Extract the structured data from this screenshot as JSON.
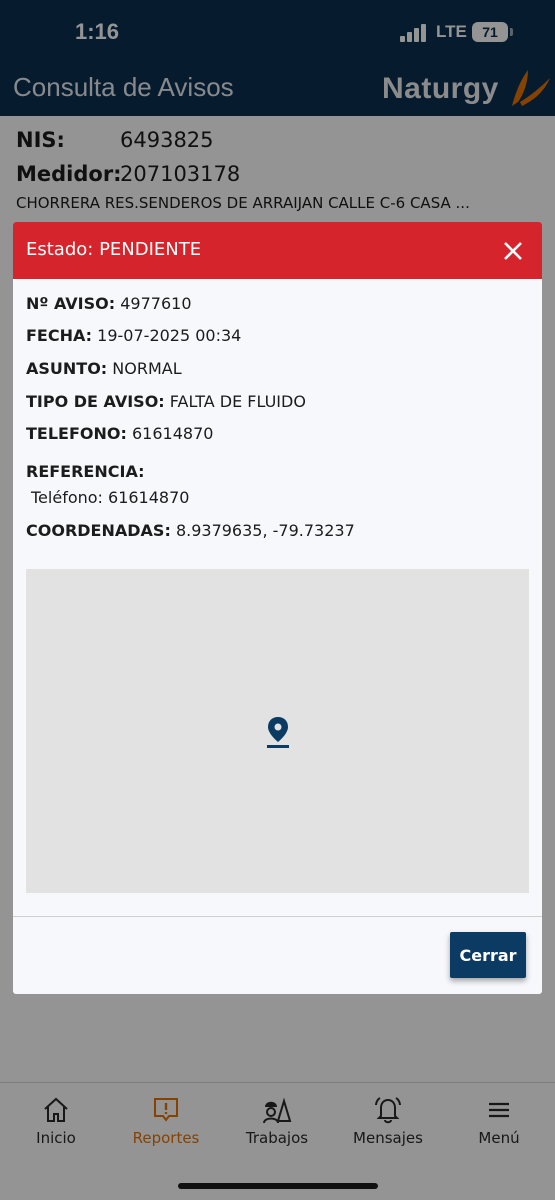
{
  "status_bar": {
    "time": "1:16",
    "network": "LTE",
    "battery": "71"
  },
  "header": {
    "title": "Consulta de Avisos",
    "brand": "Naturgy"
  },
  "info": {
    "nis_label": "NIS:",
    "nis_value": "6493825",
    "medidor_label": "Medidor:",
    "medidor_value": "207103178",
    "address": "CHORRERA RES.SENDEROS DE ARRAIJAN CALLE C-6 CASA ..."
  },
  "modal": {
    "title": "Estado: PENDIENTE",
    "header_color": "#d6242d",
    "fields": {
      "aviso_label": "Nº AVISO:",
      "aviso_value": "4977610",
      "fecha_label": "FECHA:",
      "fecha_value": "19-07-2025 00:34",
      "asunto_label": "ASUNTO:",
      "asunto_value": "NORMAL",
      "tipo_label": "TIPO DE AVISO:",
      "tipo_value": "FALTA DE FLUIDO",
      "telefono_label": "TELEFONO:",
      "telefono_value": "61614870",
      "referencia_label": "REFERENCIA:",
      "referencia_value": "Teléfono: 61614870",
      "coordenadas_label": "COORDENADAS:",
      "coordenadas_value": "8.9379635, -79.73237"
    },
    "close_button": "Cerrar"
  },
  "tabbar": {
    "items": [
      {
        "label": "Inicio",
        "icon": "home-icon"
      },
      {
        "label": "Reportes",
        "icon": "report-icon",
        "active": true
      },
      {
        "label": "Trabajos",
        "icon": "worker-icon"
      },
      {
        "label": "Mensajes",
        "icon": "bell-icon"
      },
      {
        "label": "Menú",
        "icon": "menu-icon"
      }
    ],
    "active_color": "#e57200"
  }
}
